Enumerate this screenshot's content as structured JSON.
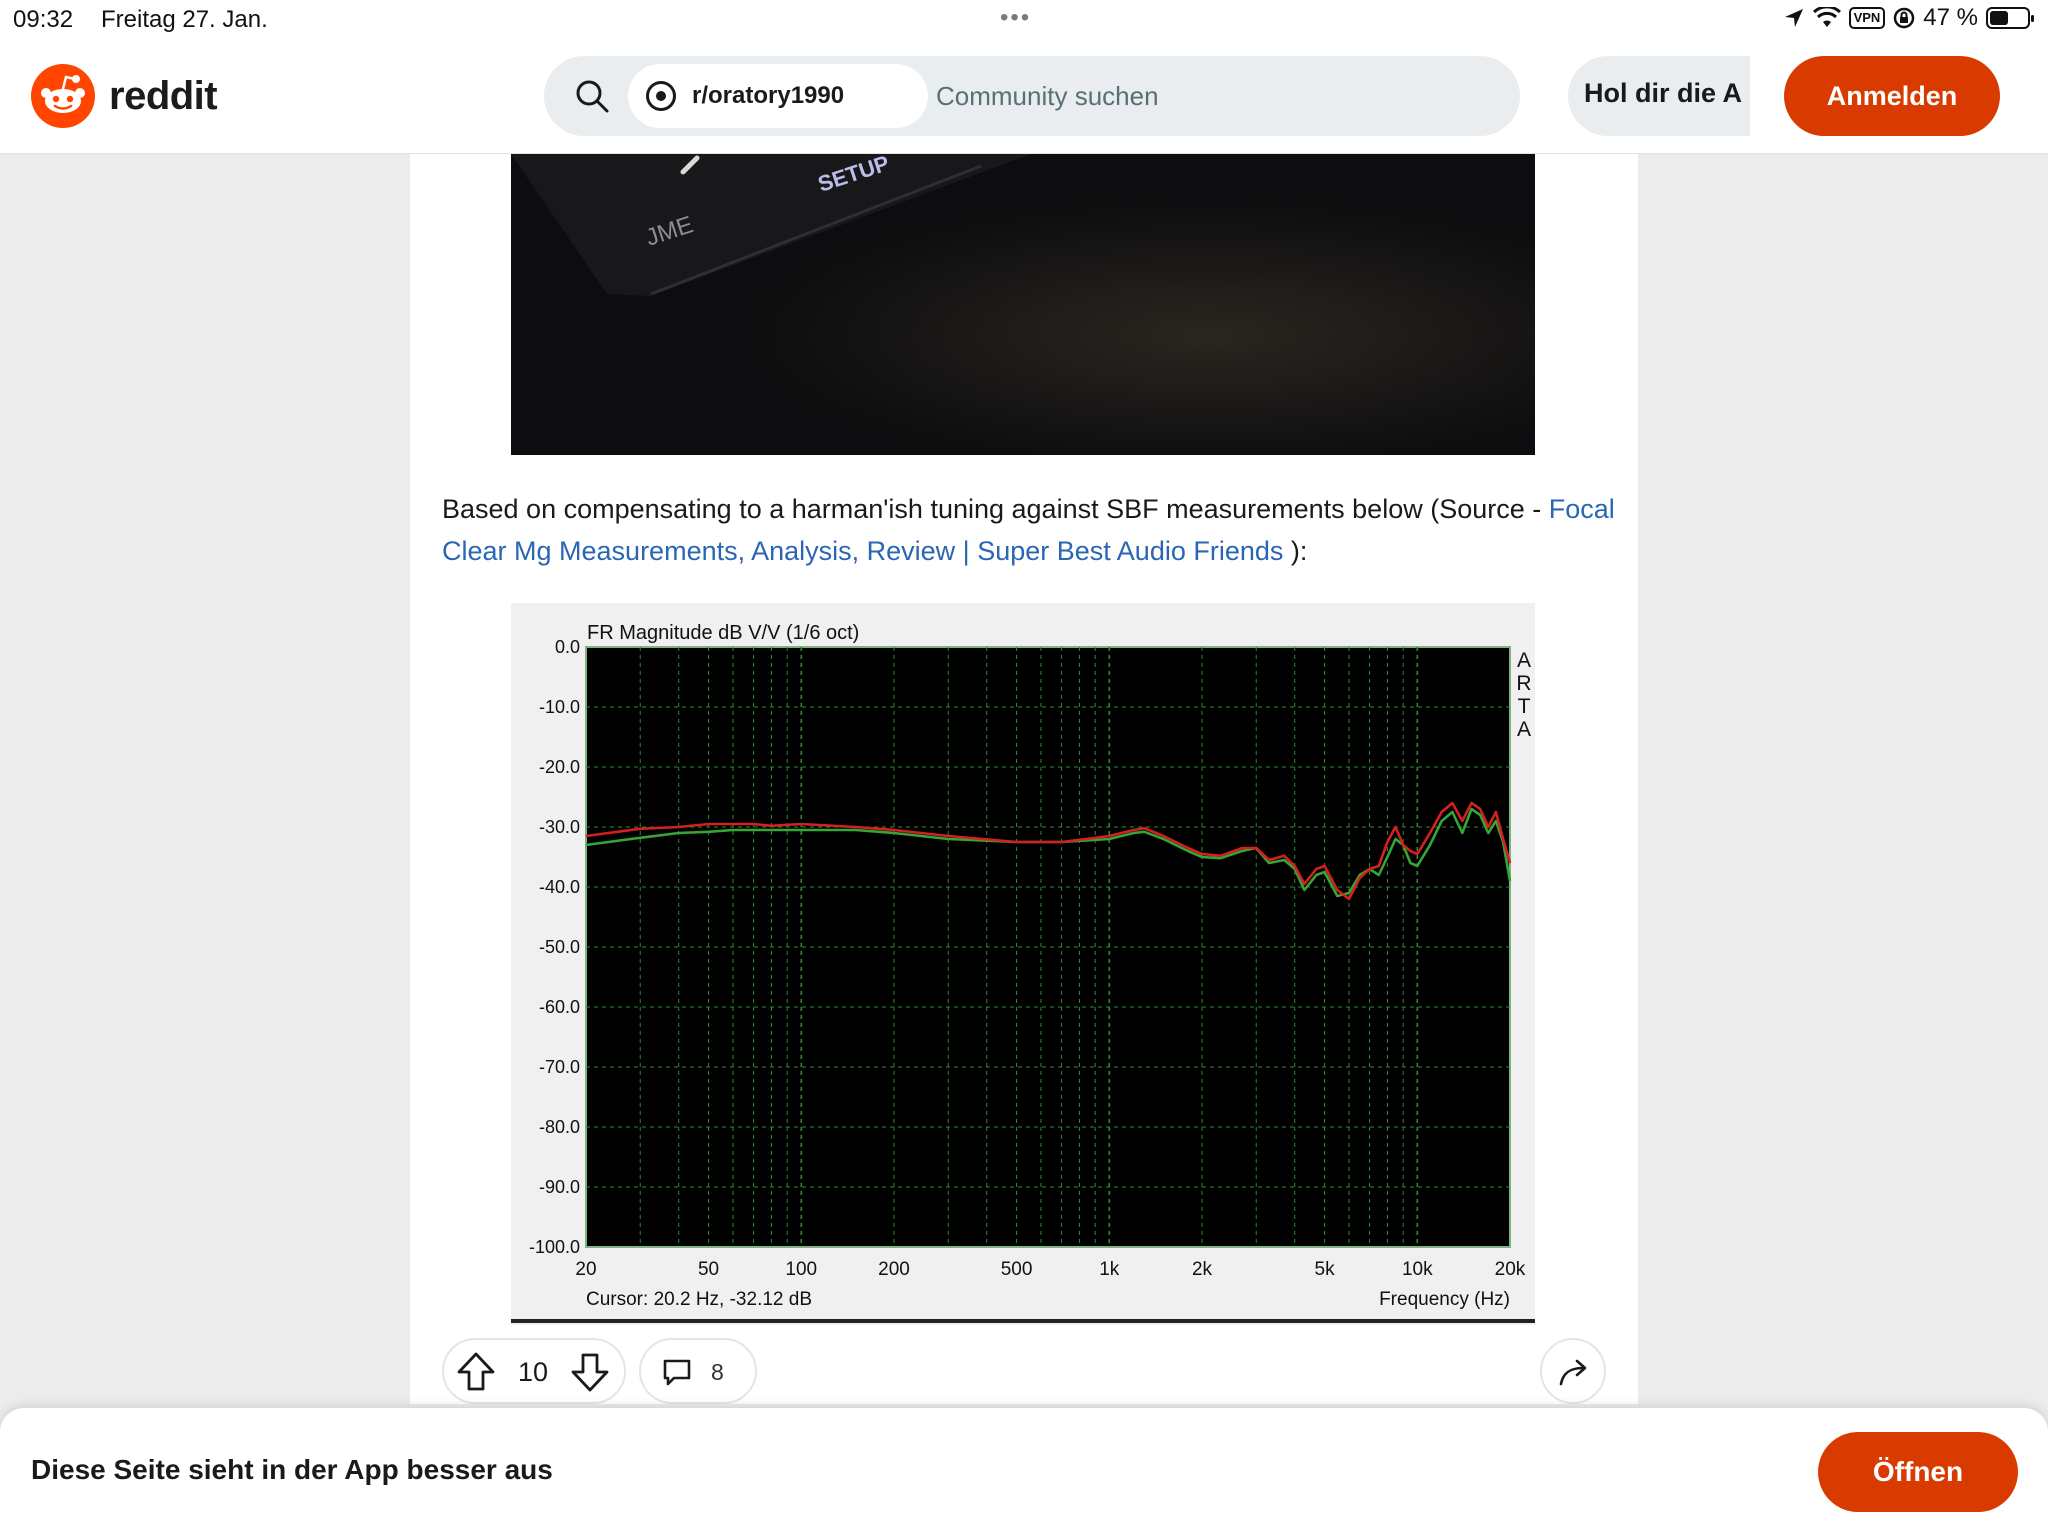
{
  "status_bar": {
    "time": "09:32",
    "date": "Freitag 27. Jan.",
    "vpn": "VPN",
    "battery": "47 %"
  },
  "header": {
    "logo_text": "reddit",
    "community_chip": "r/oratory1990",
    "search_placeholder": "Community suchen",
    "get_app": "Hol dir die A",
    "login": "Anmelden"
  },
  "post": {
    "photo_labels": [
      "JME",
      "SETUP"
    ],
    "text_before_link": "Based on compensating to a harman'ish tuning against SBF measurements below (Source - ",
    "link_text": "Focal Clear Mg Measurements, Analysis, Review | Super Best Audio Friends",
    "text_after_link": " ):",
    "upvotes": "10",
    "comments": "8"
  },
  "banner": {
    "message": "Diese Seite sieht in der App besser aus",
    "open": "Öffnen"
  },
  "colors": {
    "brand": "#d93a00",
    "link": "#2a66b4",
    "plot_bg": "#000000",
    "grid": "#2e8b2e",
    "series_red": "#d42020",
    "series_green": "#35a535"
  },
  "chart_data": {
    "type": "line",
    "title": "FR Magnitude dB V/V (1/6 oct)",
    "xlabel": "Frequency (Hz)",
    "ylabel": "",
    "x_scale": "log",
    "xlim": [
      20,
      20000
    ],
    "ylim": [
      -100,
      0
    ],
    "x_ticks": [
      20,
      50,
      100,
      200,
      500,
      1000,
      2000,
      5000,
      10000,
      20000
    ],
    "x_tick_labels": [
      "20",
      "50",
      "100",
      "200",
      "500",
      "1k",
      "2k",
      "5k",
      "10k",
      "20k"
    ],
    "y_ticks": [
      0,
      -10,
      -20,
      -30,
      -40,
      -50,
      -60,
      -70,
      -80,
      -90,
      -100
    ],
    "y_tick_labels": [
      "0.0",
      "-10.0",
      "-20.0",
      "-30.0",
      "-40.0",
      "-50.0",
      "-60.0",
      "-70.0",
      "-80.0",
      "-90.0",
      "-100.0"
    ],
    "side_label": [
      "A",
      "R",
      "T",
      "A"
    ],
    "cursor_text": "Cursor: 20.2 Hz, -32.12 dB",
    "grid": true,
    "legend": "none",
    "series": [
      {
        "color": "#d42020",
        "x": [
          20,
          30,
          40,
          50,
          60,
          70,
          80,
          100,
          150,
          200,
          300,
          500,
          700,
          1000,
          1200,
          1300,
          1500,
          1800,
          2000,
          2300,
          2700,
          3000,
          3300,
          3700,
          4000,
          4300,
          4700,
          5000,
          5500,
          6000,
          6500,
          7000,
          7500,
          8000,
          8500,
          9000,
          9500,
          10000,
          11000,
          12000,
          13000,
          14000,
          15000,
          16000,
          17000,
          18000,
          19000,
          20000
        ],
        "y": [
          -31.5,
          -30.3,
          -30,
          -29.5,
          -29.5,
          -29.5,
          -29.8,
          -29.5,
          -30,
          -30.5,
          -31.5,
          -32.5,
          -32.5,
          -31.5,
          -30.5,
          -30.2,
          -31.5,
          -33.5,
          -34.5,
          -34.8,
          -33.5,
          -33.5,
          -35.5,
          -34.8,
          -36.5,
          -39.5,
          -37,
          -36.5,
          -40.5,
          -42,
          -38.5,
          -37,
          -36.5,
          -32.5,
          -30,
          -33,
          -34,
          -34.5,
          -31,
          -27.5,
          -26,
          -29,
          -26,
          -27,
          -30,
          -27.5,
          -32,
          -36
        ]
      },
      {
        "color": "#35a535",
        "x": [
          20,
          30,
          40,
          50,
          60,
          70,
          80,
          100,
          150,
          200,
          300,
          500,
          700,
          1000,
          1200,
          1300,
          1500,
          1800,
          2000,
          2300,
          2700,
          3000,
          3300,
          3700,
          4000,
          4300,
          4700,
          5000,
          5500,
          6000,
          6500,
          7000,
          7500,
          8000,
          8500,
          9000,
          9500,
          10000,
          11000,
          12000,
          13000,
          14000,
          15000,
          16000,
          17000,
          18000,
          19000,
          20000
        ],
        "y": [
          -33,
          -31.8,
          -31,
          -30.8,
          -30.5,
          -30.5,
          -30.5,
          -30.5,
          -30.5,
          -31,
          -32,
          -32.5,
          -32.5,
          -32,
          -31,
          -30.8,
          -32,
          -34,
          -35,
          -35.2,
          -34,
          -33.5,
          -36,
          -35.5,
          -37,
          -40.5,
          -38,
          -37.5,
          -41.5,
          -41,
          -38,
          -37,
          -38,
          -35,
          -32,
          -33,
          -36,
          -36.5,
          -33,
          -29,
          -27.5,
          -31,
          -27,
          -28,
          -31,
          -29,
          -32.5,
          -39
        ]
      }
    ]
  }
}
